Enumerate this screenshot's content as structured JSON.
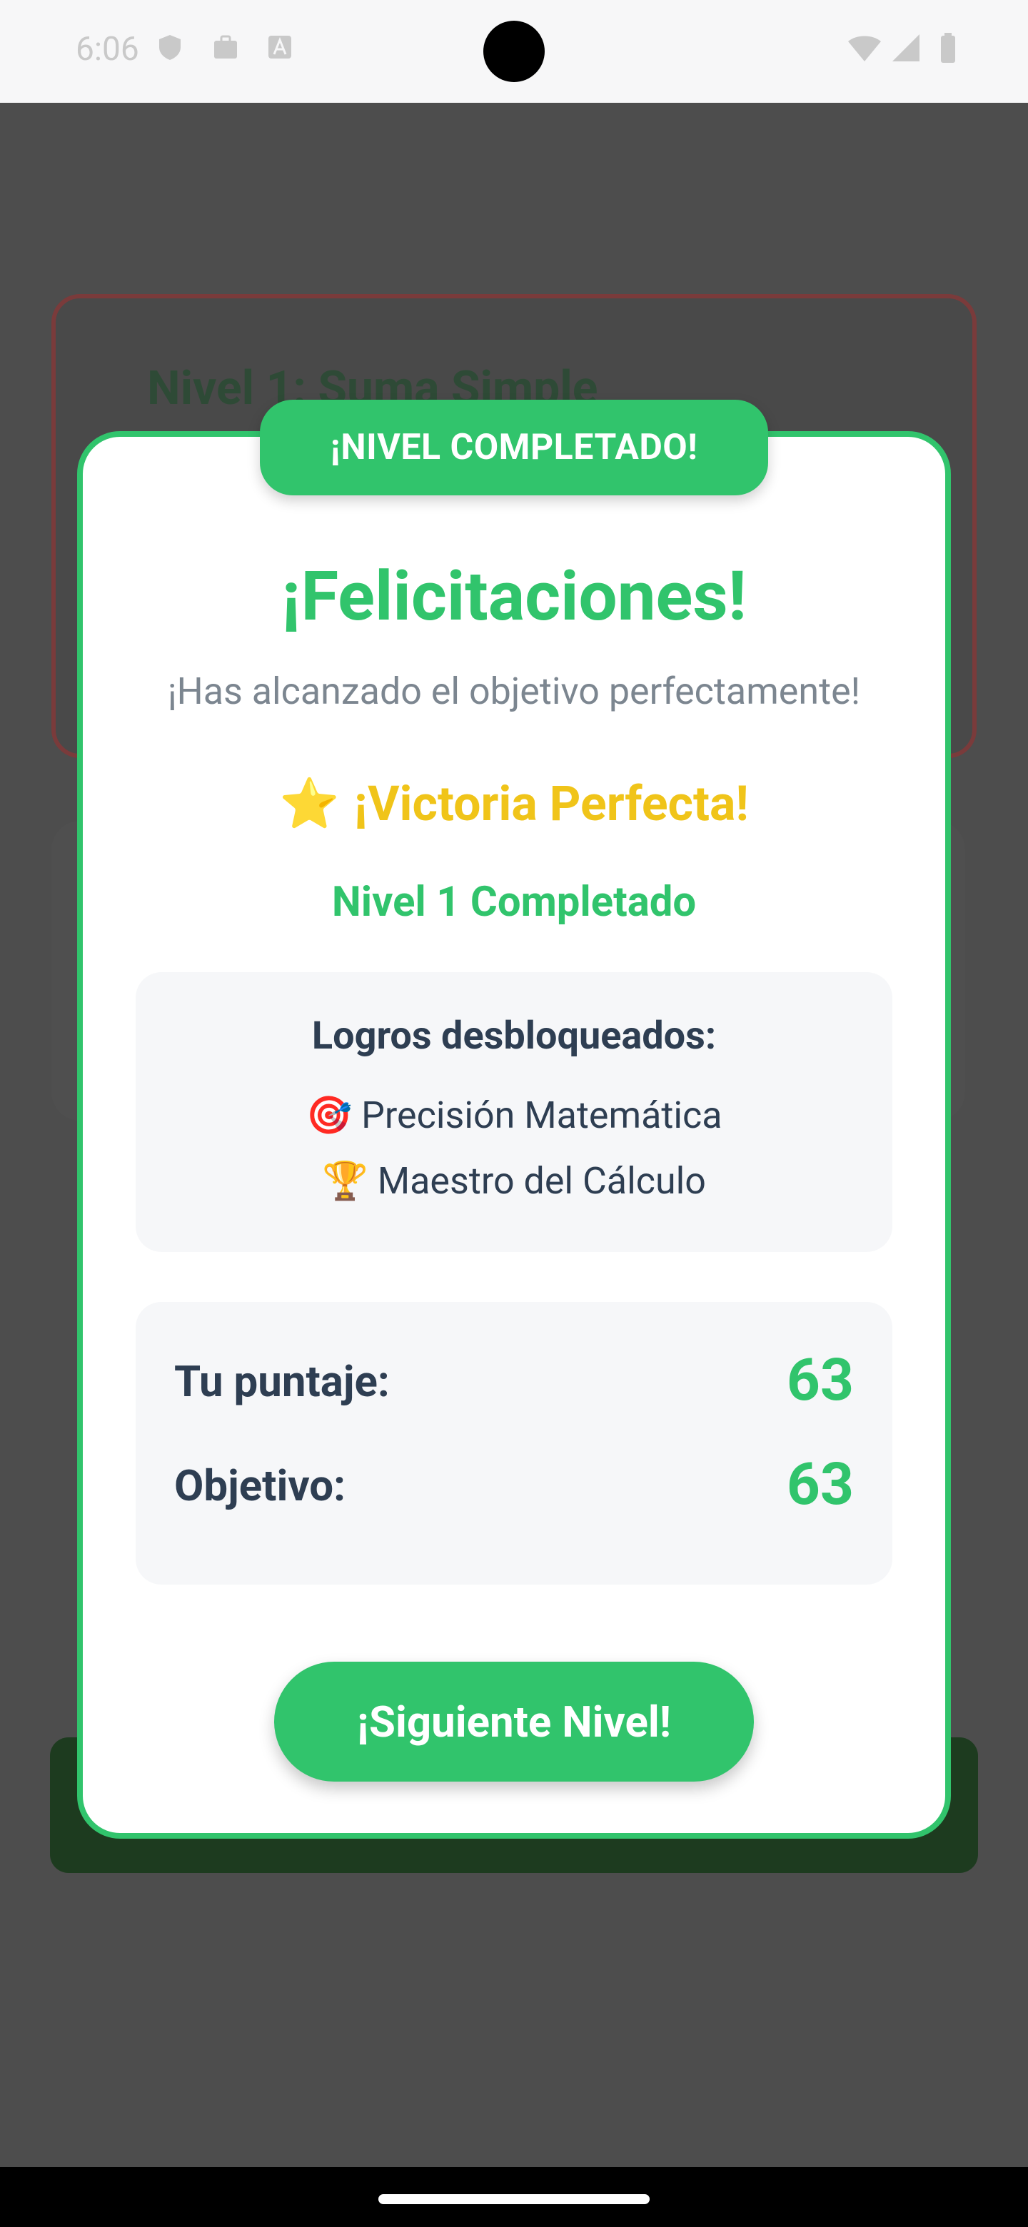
{
  "status_bar": {
    "time": "6:06",
    "icons": [
      "shield-icon",
      "briefcase-icon",
      "font-icon",
      "wifi-icon",
      "signal-icon",
      "battery-icon"
    ]
  },
  "background": {
    "level_title": "Nivel 1: Suma Simple"
  },
  "modal": {
    "badge": "¡NIVEL COMPLETADO!",
    "title": "¡Felicitaciones!",
    "subtitle": "¡Has alcanzado el objetivo perfectamente!",
    "victory_icon": "⭐",
    "victory_text": "¡Victoria Perfecta!",
    "level_completed": "Nivel 1 Completado",
    "achievements": {
      "title": "Logros desbloqueados:",
      "items": [
        {
          "icon": "🎯",
          "text": "Precisión Matemática"
        },
        {
          "icon": "🏆",
          "text": "Maestro del Cálculo"
        }
      ]
    },
    "scores": {
      "score_label": "Tu puntaje:",
      "score_value": "63",
      "target_label": "Objetivo:",
      "target_value": "63"
    },
    "next_button": "¡Siguiente Nivel!"
  },
  "colors": {
    "accent": "#31c46c",
    "gold": "#f0c419",
    "text_dark": "#2e3e52",
    "text_muted": "#7c8690",
    "overlay": "#4d4d4d"
  }
}
